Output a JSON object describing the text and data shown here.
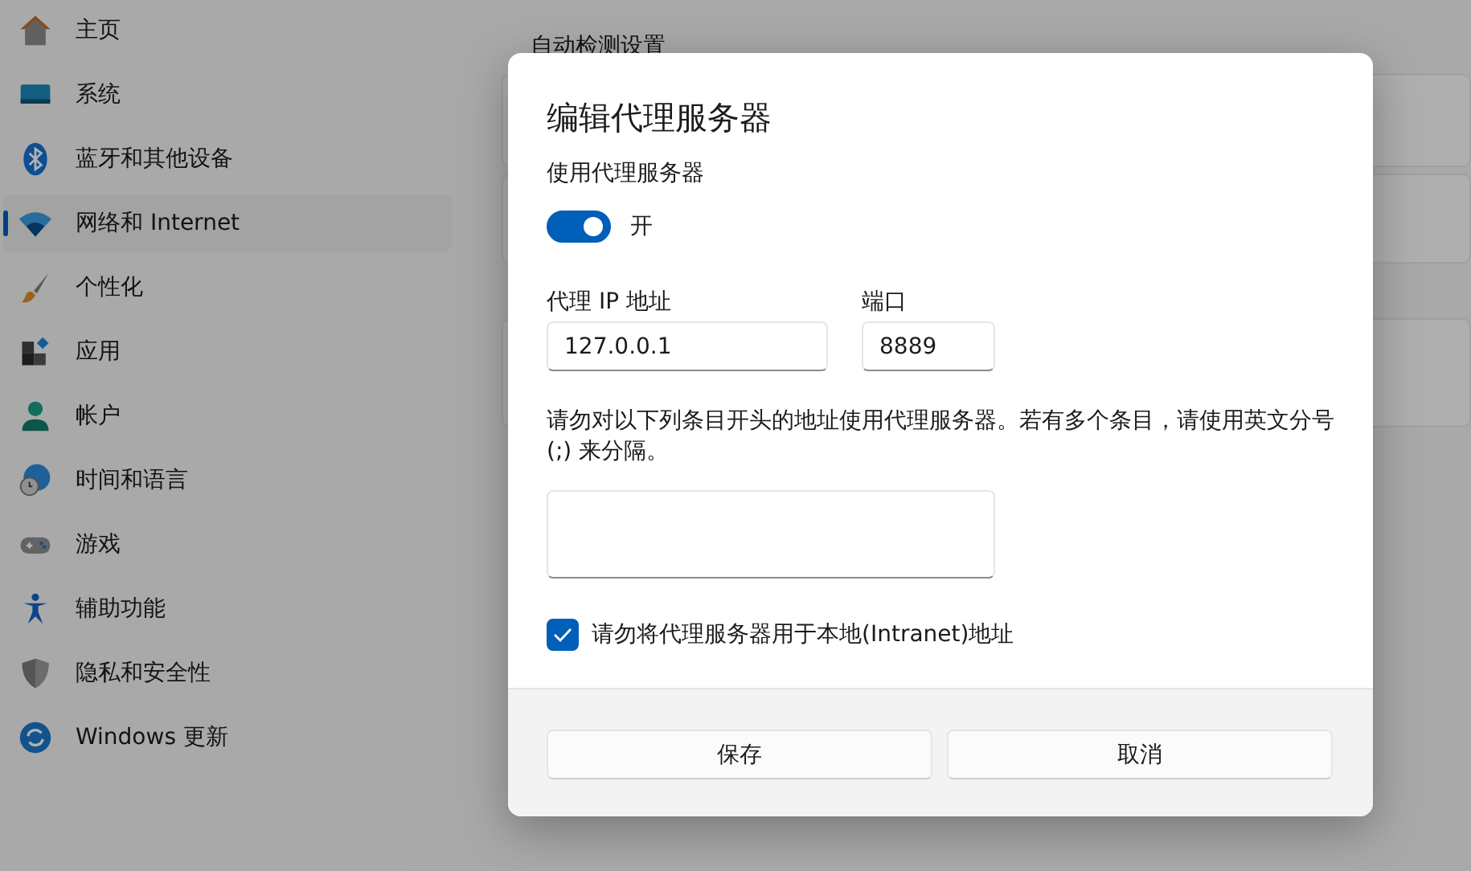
{
  "sidebar": {
    "items": [
      {
        "label": "主页",
        "kind": "home",
        "selected": false
      },
      {
        "label": "系统",
        "kind": "system",
        "selected": false
      },
      {
        "label": "蓝牙和其他设备",
        "kind": "bluetooth",
        "selected": false
      },
      {
        "label": "网络和 Internet",
        "kind": "wifi",
        "selected": true
      },
      {
        "label": "个性化",
        "kind": "brush",
        "selected": false
      },
      {
        "label": "应用",
        "kind": "apps",
        "selected": false
      },
      {
        "label": "帐户",
        "kind": "person",
        "selected": false
      },
      {
        "label": "时间和语言",
        "kind": "globe",
        "selected": false
      },
      {
        "label": "游戏",
        "kind": "gamepad",
        "selected": false
      },
      {
        "label": "辅助功能",
        "kind": "accessibility",
        "selected": false
      },
      {
        "label": "隐私和安全性",
        "kind": "shield",
        "selected": false
      },
      {
        "label": "Windows 更新",
        "kind": "update",
        "selected": false
      }
    ]
  },
  "content": {
    "section_title": "自动检测设置"
  },
  "dialog": {
    "title": "编辑代理服务器",
    "proxy_toggle": {
      "label": "使用代理服务器",
      "on": true,
      "state_text": "开"
    },
    "fields": [
      {
        "label": "代理 IP 地址",
        "value": "127.0.0.1"
      },
      {
        "label": "端口",
        "value": "8889"
      }
    ],
    "exceptions": {
      "description": "请勿对以下列条目开头的地址使用代理服务器。若有多个条目，请使用英文分号 (;) 来分隔。"
    },
    "bypass_local": {
      "label": "请勿将代理服务器用于本地(Intranet)地址",
      "checked": true
    },
    "buttons": [
      "保存",
      "取消"
    ]
  }
}
